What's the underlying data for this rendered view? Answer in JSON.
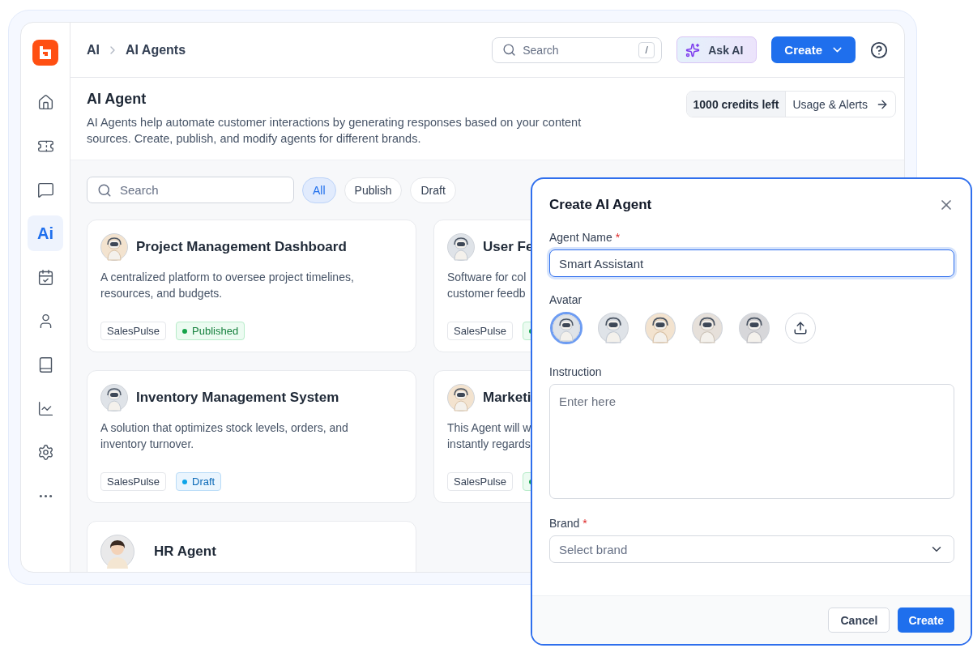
{
  "sidebar": {
    "items": [
      {
        "kind": "icon",
        "selected": false
      },
      {
        "kind": "icon",
        "selected": false
      },
      {
        "kind": "icon",
        "selected": false
      },
      {
        "kind": "text",
        "label": "Ai",
        "selected": true
      },
      {
        "kind": "icon",
        "selected": false
      },
      {
        "kind": "icon",
        "selected": false
      },
      {
        "kind": "icon",
        "selected": false
      },
      {
        "kind": "icon",
        "selected": false
      },
      {
        "kind": "icon",
        "selected": false
      },
      {
        "kind": "icon",
        "selected": false
      }
    ]
  },
  "breadcrumb": [
    "AI",
    "AI Agents"
  ],
  "topbar": {
    "search": {
      "placeholder": "Search",
      "shortcut": "/"
    },
    "ask_ai": "Ask AI",
    "create": "Create"
  },
  "page": {
    "title": "AI Agent",
    "description": "AI Agents help automate customer interactions by generating responses based on your content sources. Create, publish, and modify agents for different brands.",
    "credits": "1000 credits left",
    "usage_link": "Usage & Alerts"
  },
  "filters": {
    "search": {
      "placeholder": "Search"
    },
    "chips": [
      {
        "label": "All",
        "selected": true
      },
      {
        "label": "Publish",
        "selected": false
      },
      {
        "label": "Draft",
        "selected": false
      }
    ]
  },
  "cards": [
    {
      "title": "Project Management Dashboard",
      "lines": [
        "A centralized platform to oversee project timelines,",
        "resources, and budgets."
      ],
      "brand": "SalesPulse",
      "status": {
        "kind": "published",
        "label": "Published"
      }
    },
    {
      "title": "User Fe",
      "lines": [
        "Software for col",
        "customer feedb"
      ],
      "brand": "SalesPulse",
      "status": {
        "kind": "published"
      }
    },
    {
      "title": "Inventory Management System",
      "lines": [
        "A solution that optimizes stock levels, orders, and",
        "inventory turnover."
      ],
      "brand": "SalesPulse",
      "status": {
        "kind": "draft",
        "label": "Draft"
      }
    },
    {
      "title": "Marketi",
      "lines": [
        "This Agent will w",
        "instantly regards"
      ],
      "brand": "SalesPulse",
      "status": {
        "kind": "published"
      }
    },
    {
      "title": "HR Agent"
    }
  ],
  "modal": {
    "title": "Create AI Agent",
    "name_label": "Agent Name",
    "name_value": "Smart Assistant",
    "avatar_label": "Avatar",
    "avatars": [
      {
        "selected": true
      },
      {
        "selected": false
      },
      {
        "selected": false
      },
      {
        "selected": false
      },
      {
        "selected": false
      }
    ],
    "instruction_label": "Instruction",
    "instruction_placeholder": "Enter here",
    "brand_label": "Brand",
    "brand_placeholder": "Select brand",
    "required_mark": "*",
    "cancel": "Cancel",
    "create": "Create"
  }
}
